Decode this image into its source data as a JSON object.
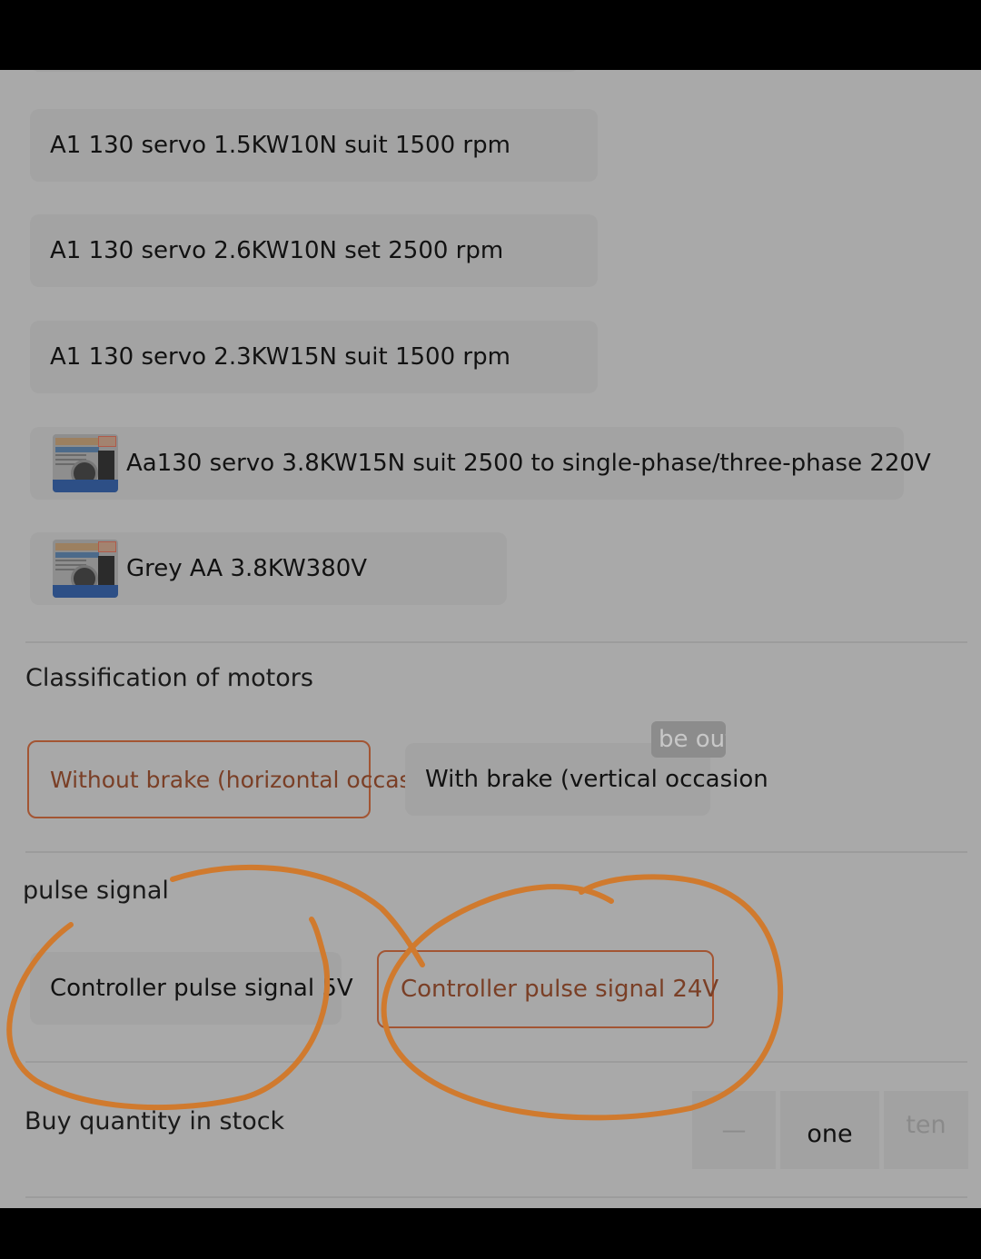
{
  "variants": [
    "A1 130 servo 1.5KW10N suit 1500 rpm",
    "A1 130 servo 2.6KW10N set 2500 rpm",
    "A1 130 servo 2.3KW15N suit 1500 rpm",
    "Aa130 servo 3.8KW15N suit 2500 to single-phase/three-phase 220V",
    "Grey AA 3.8KW380V"
  ],
  "motor_classification": {
    "label": "Classification of motors",
    "options": [
      "Without brake (horizontal occasion",
      "With brake (vertical occasion"
    ],
    "selected": "Without brake (horizontal occasion",
    "tooltip": "be out"
  },
  "pulse_signal": {
    "label": "pulse signal",
    "options": [
      "Controller pulse signal 5V",
      "Controller pulse signal 24V"
    ],
    "selected": "Controller pulse signal 24V"
  },
  "quantity": {
    "label": "Buy quantity in stock",
    "decrement": "—",
    "value": "one",
    "increment": "ten"
  },
  "colors": {
    "background": "#a9a9a9",
    "selected_border": "#a35533",
    "annotation": "#d07a2e"
  }
}
